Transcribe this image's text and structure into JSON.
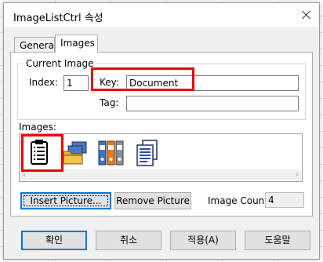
{
  "window": {
    "title": "ImageListCtrl 속성"
  },
  "tabs": [
    {
      "label": "General"
    },
    {
      "label": "Images"
    }
  ],
  "current_image": {
    "group_title": "Current Image",
    "index_label": "Index:",
    "index_value": "1",
    "key_label": "Key:",
    "key_value": "Document",
    "tag_label": "Tag:",
    "tag_value": ""
  },
  "images": {
    "label": "Images:",
    "items": [
      {
        "icon": "clipboard-list-icon"
      },
      {
        "icon": "folders-icon"
      },
      {
        "icon": "binders-icon"
      },
      {
        "icon": "documents-icon"
      }
    ]
  },
  "actions": {
    "insert_label": "Insert Picture...",
    "remove_label": "Remove Picture",
    "count_label": "Image Count:",
    "count_value": "4"
  },
  "dialog_buttons": {
    "ok": "확인",
    "cancel": "취소",
    "apply": "적용(A)",
    "help": "도움말"
  },
  "colors": {
    "highlight": "#ee0000",
    "focus_blue": "#0078d7"
  }
}
